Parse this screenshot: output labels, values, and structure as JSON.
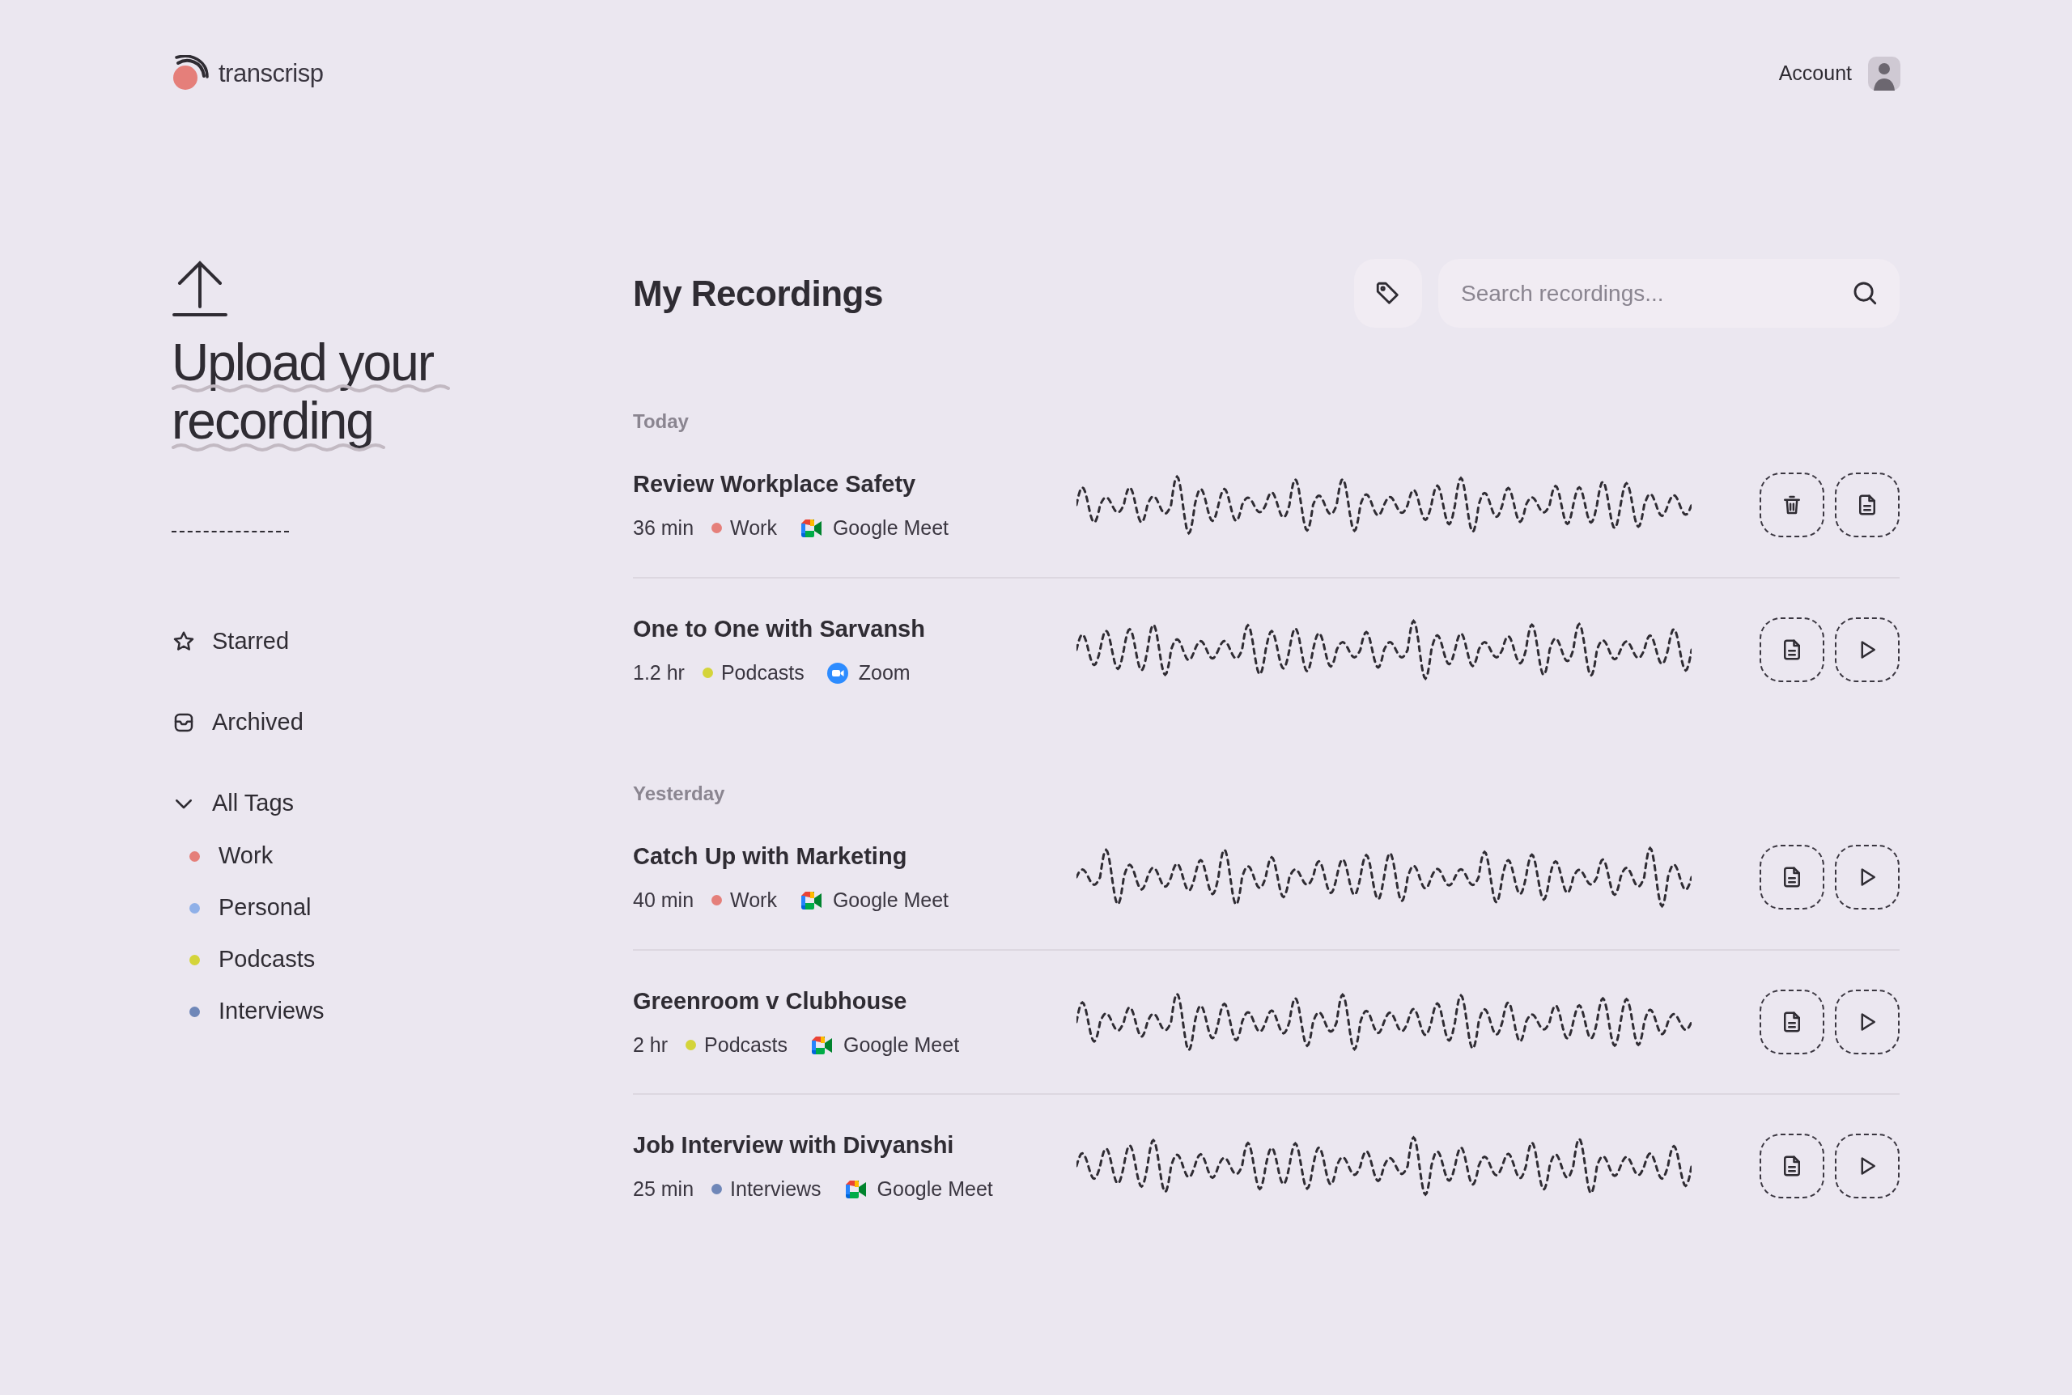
{
  "brand": {
    "name": "transcrisp"
  },
  "account": {
    "label": "Account"
  },
  "upload": {
    "heading": "Upload your recording"
  },
  "nav": [
    {
      "kind": "starred",
      "label": "Starred"
    },
    {
      "kind": "archived",
      "label": "Archived"
    }
  ],
  "tags": {
    "label": "All Tags",
    "expanded": true,
    "items": [
      {
        "label": "Work",
        "color": "#e57f7a"
      },
      {
        "label": "Personal",
        "color": "#8fb0e8"
      },
      {
        "label": "Podcasts",
        "color": "#d4d43a"
      },
      {
        "label": "Interviews",
        "color": "#6f87b8"
      }
    ]
  },
  "main": {
    "title": "My Recordings",
    "search": {
      "placeholder": "Search recordings..."
    }
  },
  "groups": [
    {
      "label": "Today",
      "recordings": [
        {
          "title": "Review Workplace Safety",
          "duration": "36 min",
          "tag": {
            "label": "Work",
            "color": "#e57f7a"
          },
          "platform": {
            "label": "Google Meet",
            "kind": "meet"
          },
          "actions": [
            {
              "kind": "delete"
            },
            {
              "kind": "transcript"
            }
          ]
        },
        {
          "title": "One to One with Sarvansh",
          "duration": "1.2 hr",
          "tag": {
            "label": "Podcasts",
            "color": "#d4d43a"
          },
          "platform": {
            "label": "Zoom",
            "kind": "zoom"
          },
          "actions": [
            {
              "kind": "transcript"
            },
            {
              "kind": "play"
            }
          ]
        }
      ]
    },
    {
      "label": "Yesterday",
      "recordings": [
        {
          "title": "Catch Up with Marketing",
          "duration": "40 min",
          "tag": {
            "label": "Work",
            "color": "#e57f7a"
          },
          "platform": {
            "label": "Google Meet",
            "kind": "meet"
          },
          "actions": [
            {
              "kind": "transcript"
            },
            {
              "kind": "play"
            }
          ]
        },
        {
          "title": "Greenroom v Clubhouse",
          "duration": "2 hr",
          "tag": {
            "label": "Podcasts",
            "color": "#d4d43a"
          },
          "platform": {
            "label": "Google Meet",
            "kind": "meet"
          },
          "actions": [
            {
              "kind": "transcript"
            },
            {
              "kind": "play"
            }
          ]
        },
        {
          "title": "Job Interview with Divyanshi",
          "duration": "25 min",
          "tag": {
            "label": "Interviews",
            "color": "#6f87b8"
          },
          "platform": {
            "label": "Google Meet",
            "kind": "meet"
          },
          "actions": [
            {
              "kind": "transcript"
            },
            {
              "kind": "play"
            }
          ]
        }
      ]
    }
  ]
}
